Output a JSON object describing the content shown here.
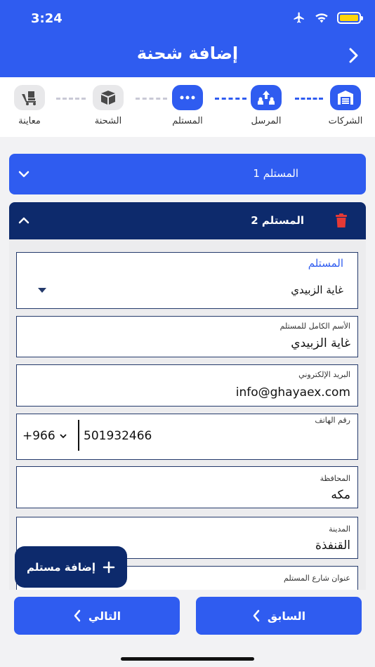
{
  "status": {
    "time": "3:24"
  },
  "header": {
    "title": "إضافة شحنة"
  },
  "stepper": {
    "steps": [
      {
        "label": "الشركات",
        "state": "done",
        "icon": "garage-icon"
      },
      {
        "label": "المرسل",
        "state": "done",
        "icon": "upload-people-icon"
      },
      {
        "label": "المستلم",
        "state": "current",
        "icon": "more-dots-icon"
      },
      {
        "label": "الشحنة",
        "state": "todo",
        "icon": "box-icon"
      },
      {
        "label": "معاينة",
        "state": "todo",
        "icon": "delivery-icon"
      }
    ]
  },
  "recipients": [
    {
      "title": "المستلم 1",
      "expanded": false
    },
    {
      "title": "المستلم 2",
      "expanded": true
    }
  ],
  "form": {
    "recipient_select": {
      "label": "المستلم",
      "value": "غاية الزبيدي"
    },
    "full_name": {
      "label": "الأسم الكامل للمستلم",
      "value": "غاية الزبيدي"
    },
    "email": {
      "label": "البريد الإلكتروني",
      "value": "info@ghayaex.com"
    },
    "phone": {
      "label": "رقم الهاتف",
      "country_code": "+966",
      "value": "501932466"
    },
    "governorate": {
      "label": "المحافظة",
      "value": "مكه"
    },
    "city": {
      "label": "المدينة",
      "value": "القنفذة"
    },
    "street": {
      "label": "عنوان شارع المستلم",
      "value": ""
    }
  },
  "actions": {
    "add_recipient": "إضافة مستلم",
    "next": "التالي",
    "previous": "السابق"
  },
  "colors": {
    "primary": "#2f5cf0",
    "dark": "#0d2a6c",
    "danger": "#e53935"
  }
}
